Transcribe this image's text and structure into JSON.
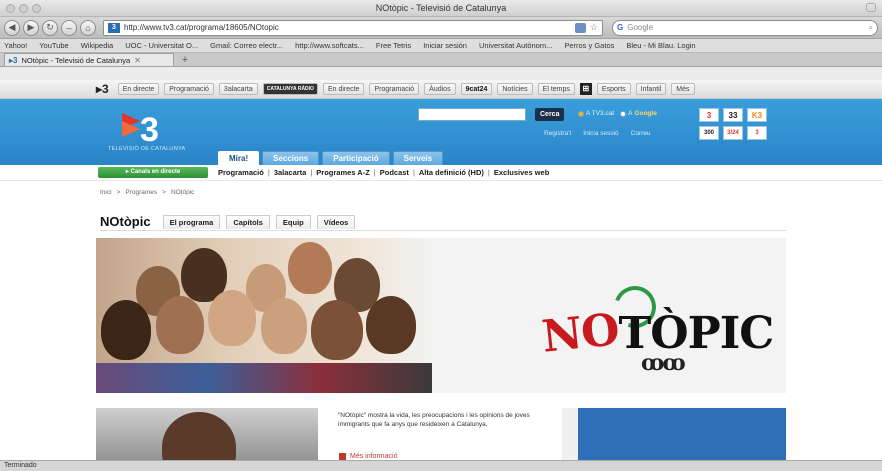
{
  "window": {
    "title": "NOtòpic - Televisió de Catalunya"
  },
  "navbar": {
    "url": "http://www.tv3.cat/programa/18605/NOtopic",
    "search_placeholder": "Google"
  },
  "bookmarks": [
    "Yahoo!",
    "YouTube",
    "Wikipedia",
    "UOC - Universitat O...",
    "Gmail: Correo electr...",
    "http://www.softcats...",
    "Free Tetris",
    "Iniciar sesión",
    "Universitat Autònom...",
    "Perros y Gatos",
    "Bleu - Mi Blau. Login"
  ],
  "tab": {
    "label": "NOtòpic - Televisió de Catalunya"
  },
  "tv3_topnav": {
    "items": [
      "En directe",
      "Programació",
      "3alacarta",
      "CATALUNYA RÀDIO",
      "En directe",
      "Programació",
      "Àudios",
      "9cat24",
      "Notícies",
      "El temps",
      "Esports",
      "Infantil",
      "Més"
    ]
  },
  "header": {
    "logo_tag": "TELEVISIÓ DE CATALUNYA",
    "search_button": "Cerca",
    "radio_tv3": "A TV3.cat",
    "radio_google": "A",
    "radio_google_brand": "Google",
    "user_links": [
      "Registra't",
      "Inicia sessió",
      "Correu"
    ],
    "channels_row1": [
      "3",
      "33",
      "K3"
    ],
    "channels_row2": [
      "300",
      "3/24",
      "3"
    ]
  },
  "main_tabs": [
    "Mira!",
    "Seccions",
    "Participació",
    "Serveis"
  ],
  "subnav": {
    "live_button": "Canals en directe",
    "links": [
      "Programació",
      "3alacarta",
      "Programes A-Z",
      "Podcast",
      "Alta definició (HD)",
      "Exclusives web"
    ]
  },
  "breadcrumb": [
    "Inici",
    "Programes",
    "NOtòpic"
  ],
  "program": {
    "title": "NOtòpic",
    "tabs": [
      "El programa",
      "Capítols",
      "Equip",
      "Vídeos"
    ]
  },
  "banner": {
    "logo_no": "NO",
    "logo_topic": "TÒPIC",
    "logo_sub": "ꝏꝏ"
  },
  "description": "\"NOtòpic\" mostra la vida, les preocupacions i les opinions de joves immigrants que fa anys que resideixen a Catalunya.",
  "more_info": "Més informació",
  "status": "Terminado",
  "colors": {
    "tv3_blue": "#2a84c8",
    "tv3_red": "#c8191f",
    "green_live": "#2e8f33"
  }
}
